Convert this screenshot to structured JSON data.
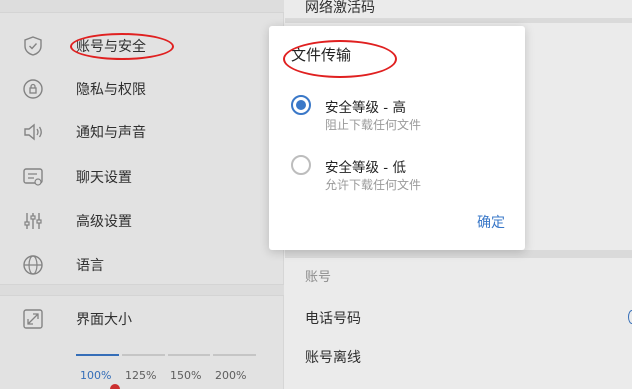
{
  "sidebar": {
    "items": [
      {
        "label": "账号与安全",
        "icon": "shield-icon"
      },
      {
        "label": "隐私与权限",
        "icon": "privacy-icon"
      },
      {
        "label": "通知与声音",
        "icon": "speaker-icon"
      },
      {
        "label": "聊天设置",
        "icon": "chat-icon"
      },
      {
        "label": "高级设置",
        "icon": "sliders-icon"
      },
      {
        "label": "语言",
        "icon": "globe-icon"
      }
    ],
    "display": {
      "label": "界面大小",
      "icon": "resize-icon"
    },
    "scale": {
      "options": [
        "100%",
        "125%",
        "150%",
        "200%"
      ],
      "selected": "100%"
    }
  },
  "panel": {
    "top_item": "网络激活码",
    "account_heading": "账号",
    "phone": "电话号码",
    "deactivate": "账号离线"
  },
  "dialog": {
    "title": "文件传输",
    "options": [
      {
        "title": "安全等级 - 高",
        "subtitle": "阻止下载任何文件",
        "checked": true
      },
      {
        "title": "安全等级 - 低",
        "subtitle": "允许下载任何文件",
        "checked": false
      }
    ],
    "confirm": "确定"
  },
  "colors": {
    "accent": "#3a78c8",
    "annotation": "#e02020"
  }
}
